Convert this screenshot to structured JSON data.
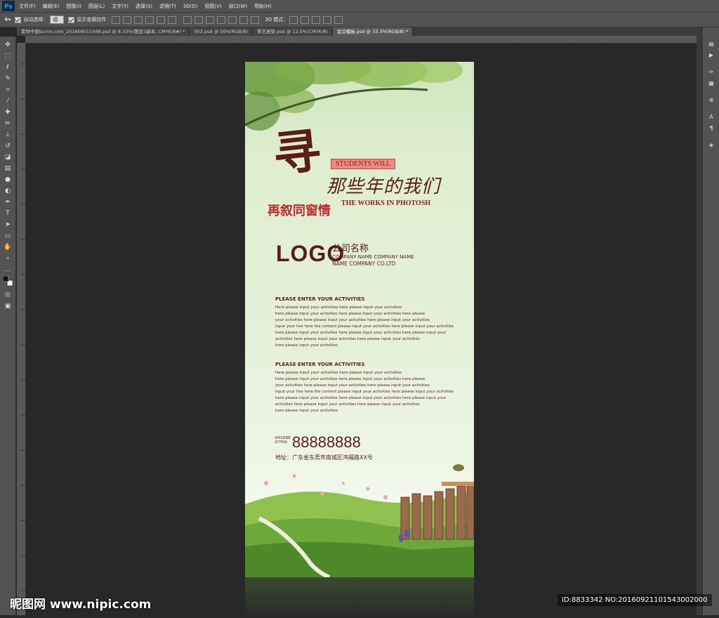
{
  "app": {
    "logo": "Ps"
  },
  "menu": [
    "文件(F)",
    "编辑(E)",
    "图像(I)",
    "图层(L)",
    "文字(Y)",
    "选择(S)",
    "滤镜(T)",
    "3D(D)",
    "视图(V)",
    "窗口(W)",
    "帮助(H)"
  ],
  "options": {
    "auto_select_label": "自动选择：",
    "auto_select_value": "组",
    "show_transform_label": "显示变换控件",
    "mode_3d_label": "3D 模式："
  },
  "tabs": [
    "素材中国sccnn.com_201608011048.psd @ 8.33%(图层3副本, CMYK/8#) *",
    "002.psd @ 50%(RGB/8)",
    "茶艺展架.psd @ 12.5%(CMYK/8)",
    "会议模板.psd @ 33.3%(RGB/8) *"
  ],
  "poster": {
    "title_big": "寻",
    "students": "STUDENTS WILL",
    "subtitle_cn": "那些年的我们",
    "red_cn": "再叙同窗情",
    "works": "THE WORKS IN PHOTOSH",
    "logo": "LOGO",
    "company_cn": "公司名称",
    "company_en1": "COMPANY NAME COMPANY NAME",
    "company_en2": "NAME COMPANY CO.LTD",
    "activities": [
      {
        "heading": "PLEASE ENTER YOUR ACTIVITIES",
        "lines": [
          "Here please input your activities here please input your activities",
          "here please input your activities here please input your activities here please",
          "your activities here please input your activities here please input your activities",
          "input your live here the content please input your activities here please input your activities",
          "here please input your activities here please input your activities here please input your",
          " activities here please input your activities here please input your activities",
          "here please input your activities"
        ]
      },
      {
        "heading": "PLEASE ENTER YOUR ACTIVITIES",
        "lines": [
          "Here please input your activities here please input your activities",
          "here please input your activities here please input your activities here please",
          "your activities here please input your activities here please input your activities",
          "input your live here the content please input your activities here please input your activities",
          "here please input your activities here please input your activities here please input your",
          " activities here please input your activities here please input your activities",
          "here please input your activities"
        ]
      }
    ],
    "vip_line1": "VIPLENE",
    "vip_line2": "(0769)",
    "phone": "88888888",
    "address": "地址：广东省东莞市南城区鸿福路XX号"
  },
  "watermark": {
    "left": "昵图网 www.nipic.com",
    "right": "ID:8833342 NO:20160921101543002000"
  },
  "colors": {
    "ui_panel": "#535353",
    "canvas_bg": "#282828",
    "poster_text": "#5a1d19",
    "accent_red": "#c0292b"
  }
}
